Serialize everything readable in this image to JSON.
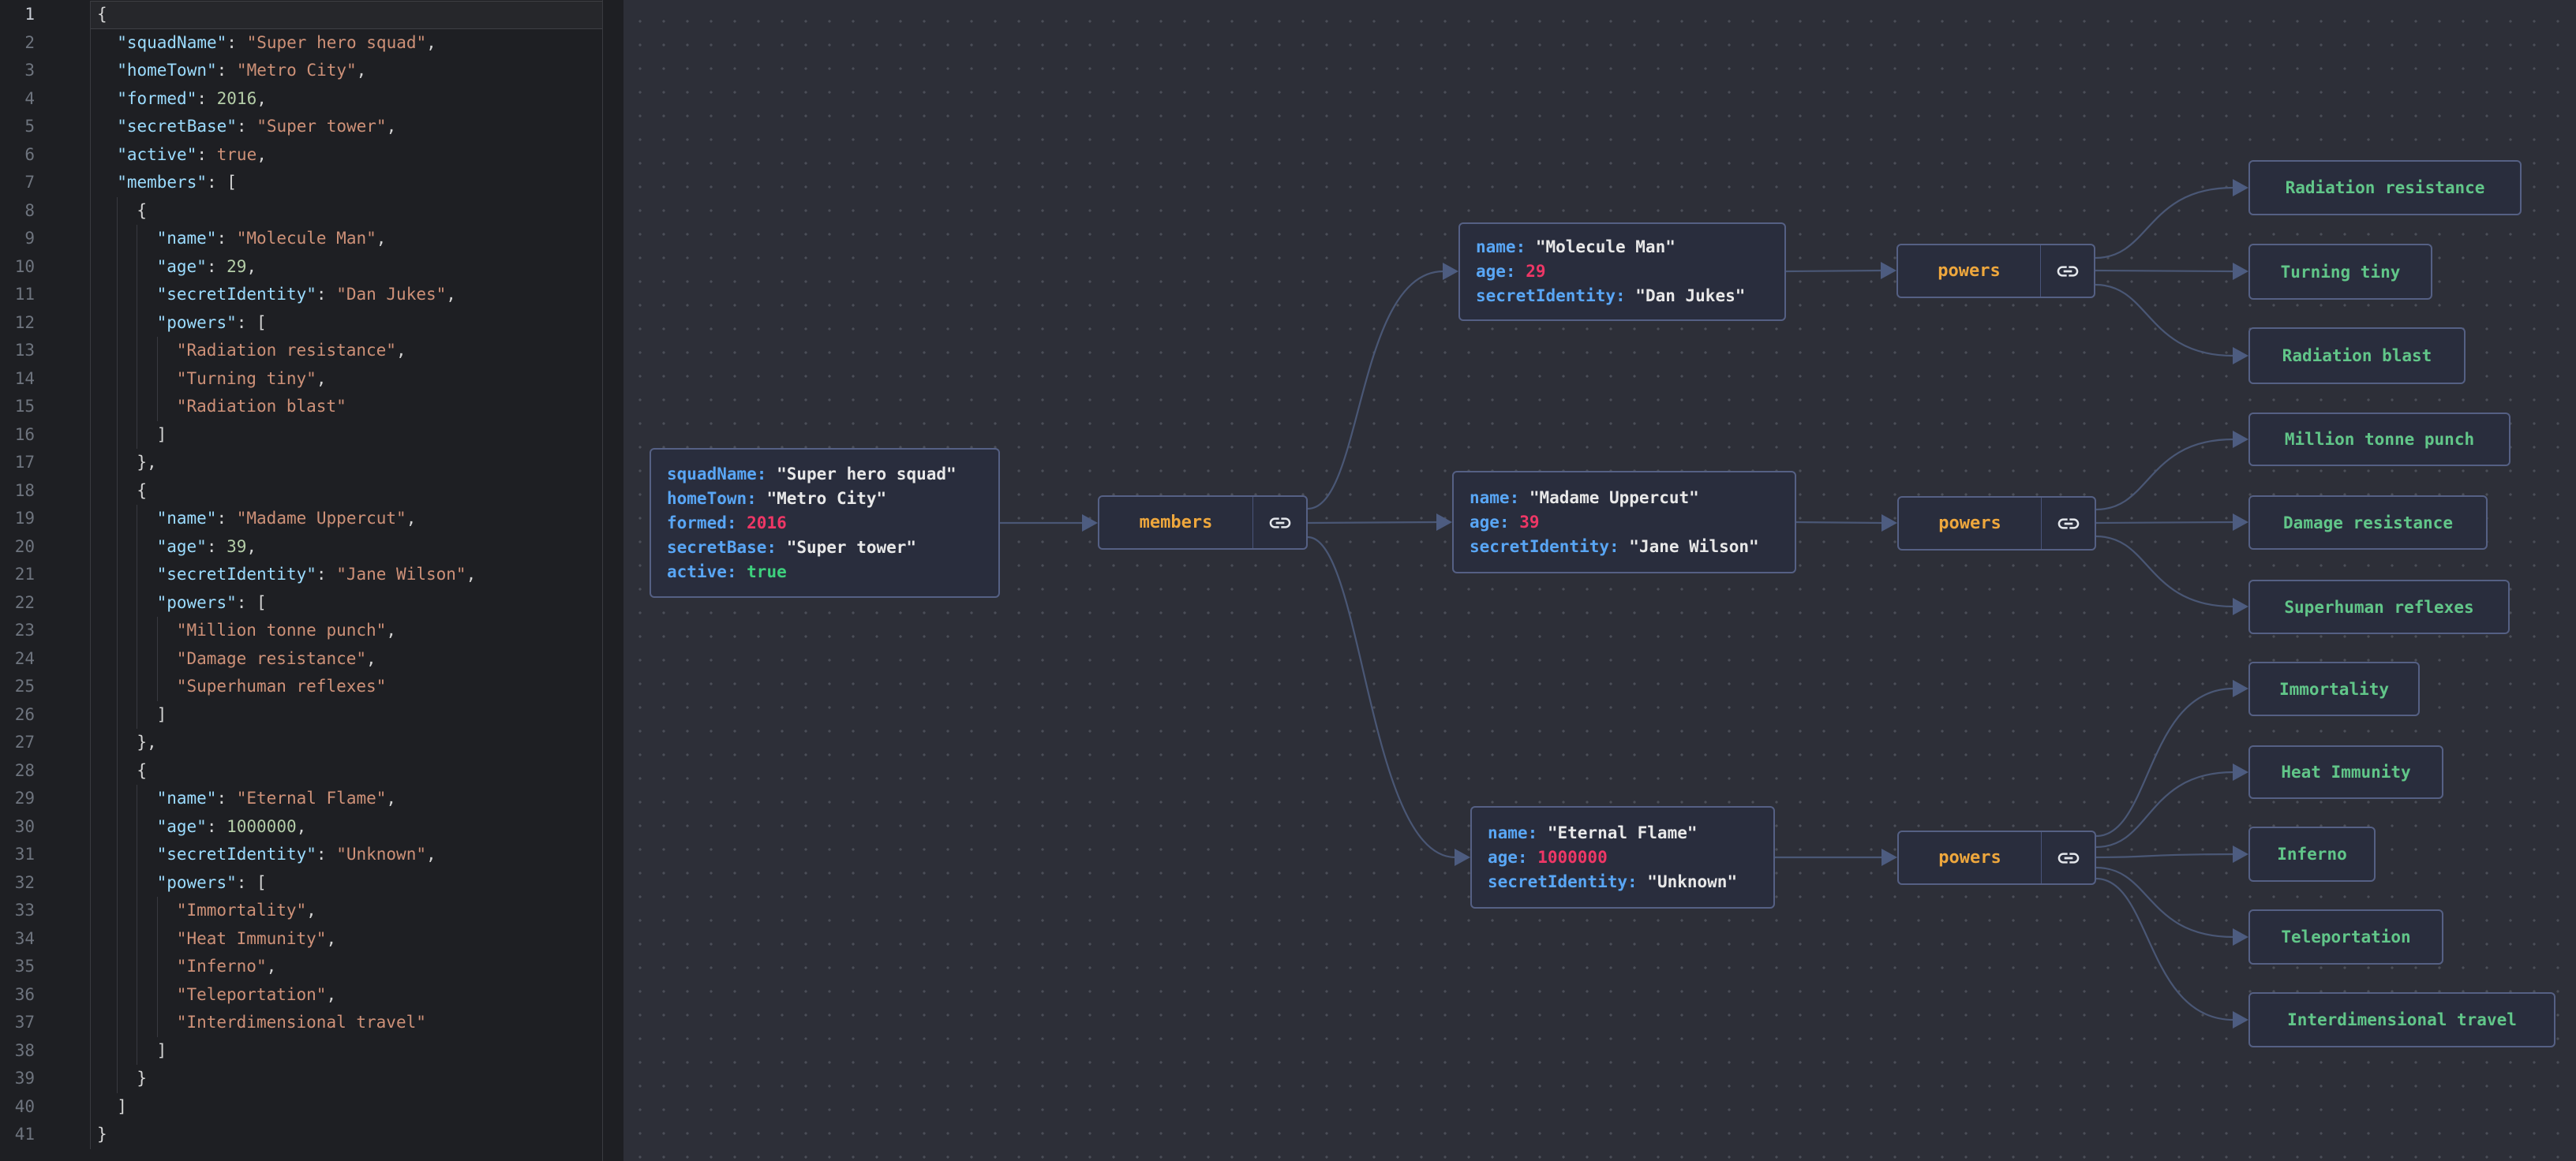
{
  "editor": {
    "lines": [
      {
        "n": 1,
        "i": 0,
        "t": [
          [
            "p",
            "{"
          ]
        ]
      },
      {
        "n": 2,
        "i": 1,
        "t": [
          [
            "k",
            "\"squadName\""
          ],
          [
            "p",
            ": "
          ],
          [
            "s",
            "\"Super hero squad\""
          ],
          [
            "p",
            ","
          ]
        ]
      },
      {
        "n": 3,
        "i": 1,
        "t": [
          [
            "k",
            "\"homeTown\""
          ],
          [
            "p",
            ": "
          ],
          [
            "s",
            "\"Metro City\""
          ],
          [
            "p",
            ","
          ]
        ]
      },
      {
        "n": 4,
        "i": 1,
        "t": [
          [
            "k",
            "\"formed\""
          ],
          [
            "p",
            ": "
          ],
          [
            "n",
            "2016"
          ],
          [
            "p",
            ","
          ]
        ]
      },
      {
        "n": 5,
        "i": 1,
        "t": [
          [
            "k",
            "\"secretBase\""
          ],
          [
            "p",
            ": "
          ],
          [
            "s",
            "\"Super tower\""
          ],
          [
            "p",
            ","
          ]
        ]
      },
      {
        "n": 6,
        "i": 1,
        "t": [
          [
            "k",
            "\"active\""
          ],
          [
            "p",
            ": "
          ],
          [
            "b",
            "true"
          ],
          [
            "p",
            ","
          ]
        ]
      },
      {
        "n": 7,
        "i": 1,
        "t": [
          [
            "k",
            "\"members\""
          ],
          [
            "p",
            ": ["
          ]
        ]
      },
      {
        "n": 8,
        "i": 2,
        "t": [
          [
            "p",
            "{"
          ]
        ]
      },
      {
        "n": 9,
        "i": 3,
        "t": [
          [
            "k",
            "\"name\""
          ],
          [
            "p",
            ": "
          ],
          [
            "s",
            "\"Molecule Man\""
          ],
          [
            "p",
            ","
          ]
        ]
      },
      {
        "n": 10,
        "i": 3,
        "t": [
          [
            "k",
            "\"age\""
          ],
          [
            "p",
            ": "
          ],
          [
            "n",
            "29"
          ],
          [
            "p",
            ","
          ]
        ]
      },
      {
        "n": 11,
        "i": 3,
        "t": [
          [
            "k",
            "\"secretIdentity\""
          ],
          [
            "p",
            ": "
          ],
          [
            "s",
            "\"Dan Jukes\""
          ],
          [
            "p",
            ","
          ]
        ]
      },
      {
        "n": 12,
        "i": 3,
        "t": [
          [
            "k",
            "\"powers\""
          ],
          [
            "p",
            ": ["
          ]
        ]
      },
      {
        "n": 13,
        "i": 4,
        "t": [
          [
            "s",
            "\"Radiation resistance\""
          ],
          [
            "p",
            ","
          ]
        ]
      },
      {
        "n": 14,
        "i": 4,
        "t": [
          [
            "s",
            "\"Turning tiny\""
          ],
          [
            "p",
            ","
          ]
        ]
      },
      {
        "n": 15,
        "i": 4,
        "t": [
          [
            "s",
            "\"Radiation blast\""
          ]
        ]
      },
      {
        "n": 16,
        "i": 3,
        "t": [
          [
            "p",
            "]"
          ]
        ]
      },
      {
        "n": 17,
        "i": 2,
        "t": [
          [
            "p",
            "},"
          ]
        ]
      },
      {
        "n": 18,
        "i": 2,
        "t": [
          [
            "p",
            "{"
          ]
        ]
      },
      {
        "n": 19,
        "i": 3,
        "t": [
          [
            "k",
            "\"name\""
          ],
          [
            "p",
            ": "
          ],
          [
            "s",
            "\"Madame Uppercut\""
          ],
          [
            "p",
            ","
          ]
        ]
      },
      {
        "n": 20,
        "i": 3,
        "t": [
          [
            "k",
            "\"age\""
          ],
          [
            "p",
            ": "
          ],
          [
            "n",
            "39"
          ],
          [
            "p",
            ","
          ]
        ]
      },
      {
        "n": 21,
        "i": 3,
        "t": [
          [
            "k",
            "\"secretIdentity\""
          ],
          [
            "p",
            ": "
          ],
          [
            "s",
            "\"Jane Wilson\""
          ],
          [
            "p",
            ","
          ]
        ]
      },
      {
        "n": 22,
        "i": 3,
        "t": [
          [
            "k",
            "\"powers\""
          ],
          [
            "p",
            ": ["
          ]
        ]
      },
      {
        "n": 23,
        "i": 4,
        "t": [
          [
            "s",
            "\"Million tonne punch\""
          ],
          [
            "p",
            ","
          ]
        ]
      },
      {
        "n": 24,
        "i": 4,
        "t": [
          [
            "s",
            "\"Damage resistance\""
          ],
          [
            "p",
            ","
          ]
        ]
      },
      {
        "n": 25,
        "i": 4,
        "t": [
          [
            "s",
            "\"Superhuman reflexes\""
          ]
        ]
      },
      {
        "n": 26,
        "i": 3,
        "t": [
          [
            "p",
            "]"
          ]
        ]
      },
      {
        "n": 27,
        "i": 2,
        "t": [
          [
            "p",
            "},"
          ]
        ]
      },
      {
        "n": 28,
        "i": 2,
        "t": [
          [
            "p",
            "{"
          ]
        ]
      },
      {
        "n": 29,
        "i": 3,
        "t": [
          [
            "k",
            "\"name\""
          ],
          [
            "p",
            ": "
          ],
          [
            "s",
            "\"Eternal Flame\""
          ],
          [
            "p",
            ","
          ]
        ]
      },
      {
        "n": 30,
        "i": 3,
        "t": [
          [
            "k",
            "\"age\""
          ],
          [
            "p",
            ": "
          ],
          [
            "n",
            "1000000"
          ],
          [
            "p",
            ","
          ]
        ]
      },
      {
        "n": 31,
        "i": 3,
        "t": [
          [
            "k",
            "\"secretIdentity\""
          ],
          [
            "p",
            ": "
          ],
          [
            "s",
            "\"Unknown\""
          ],
          [
            "p",
            ","
          ]
        ]
      },
      {
        "n": 32,
        "i": 3,
        "t": [
          [
            "k",
            "\"powers\""
          ],
          [
            "p",
            ": ["
          ]
        ]
      },
      {
        "n": 33,
        "i": 4,
        "t": [
          [
            "s",
            "\"Immortality\""
          ],
          [
            "p",
            ","
          ]
        ]
      },
      {
        "n": 34,
        "i": 4,
        "t": [
          [
            "s",
            "\"Heat Immunity\""
          ],
          [
            "p",
            ","
          ]
        ]
      },
      {
        "n": 35,
        "i": 4,
        "t": [
          [
            "s",
            "\"Inferno\""
          ],
          [
            "p",
            ","
          ]
        ]
      },
      {
        "n": 36,
        "i": 4,
        "t": [
          [
            "s",
            "\"Teleportation\""
          ],
          [
            "p",
            ","
          ]
        ]
      },
      {
        "n": 37,
        "i": 4,
        "t": [
          [
            "s",
            "\"Interdimensional travel\""
          ]
        ]
      },
      {
        "n": 38,
        "i": 3,
        "t": [
          [
            "p",
            "]"
          ]
        ]
      },
      {
        "n": 39,
        "i": 2,
        "t": [
          [
            "p",
            "}"
          ]
        ]
      },
      {
        "n": 40,
        "i": 1,
        "t": [
          [
            "p",
            "]"
          ]
        ]
      },
      {
        "n": 41,
        "i": 0,
        "t": [
          [
            "p",
            "}"
          ]
        ]
      }
    ]
  },
  "graph": {
    "root": {
      "fields": [
        [
          "squadName",
          "\"Super hero squad\"",
          "s"
        ],
        [
          "homeTown",
          "\"Metro City\"",
          "s"
        ],
        [
          "formed",
          "2016",
          "n"
        ],
        [
          "secretBase",
          "\"Super tower\"",
          "s"
        ],
        [
          "active",
          "true",
          "b"
        ]
      ]
    },
    "members_label": "members",
    "powers_label": "powers",
    "member_details": [
      {
        "fields": [
          [
            "name",
            "\"Molecule Man\"",
            "s"
          ],
          [
            "age",
            "29",
            "n"
          ],
          [
            "secretIdentity",
            "\"Dan Jukes\"",
            "s"
          ]
        ]
      },
      {
        "fields": [
          [
            "name",
            "\"Madame Uppercut\"",
            "s"
          ],
          [
            "age",
            "39",
            "n"
          ],
          [
            "secretIdentity",
            "\"Jane Wilson\"",
            "s"
          ]
        ]
      },
      {
        "fields": [
          [
            "name",
            "\"Eternal Flame\"",
            "s"
          ],
          [
            "age",
            "1000000",
            "n"
          ],
          [
            "secretIdentity",
            "\"Unknown\"",
            "s"
          ]
        ]
      }
    ],
    "leaves": [
      "Radiation resistance",
      "Turning tiny",
      "Radiation blast",
      "Million tonne punch",
      "Damage resistance",
      "Superhuman reflexes",
      "Immortality",
      "Heat Immunity",
      "Inferno",
      "Teleportation",
      "Interdimensional travel"
    ],
    "link_icon": "link-icon"
  },
  "colors": {
    "editorBg": "#1e1f23",
    "gutterLine": "#3a3b40",
    "lineNum": "#6e747e",
    "lineNumActive": "#c8ccd4",
    "activeLineBg": "#26272b",
    "activeLineBorder": "#3f4045",
    "guide": "#383940",
    "key": "#9cdcfe",
    "str": "#ce9178",
    "num": "#b5cea8",
    "bool": "#ce9178",
    "punct": "#d4d4d4",
    "canvasBg": "#2d2f38",
    "dot": "#4b4e58",
    "nodeBg": "#292d3d",
    "nodeBorder": "#556084",
    "edge": "#4a5775",
    "arrow": "#4d5c80",
    "divider": "#49547a",
    "nodeKey": "#59a6f5",
    "nodeStr": "#e8e8e8",
    "nodeNum": "#ee3766",
    "nodeBool": "#3ed17d",
    "amber": "#eea73d",
    "leafGreen": "#61c689",
    "icon": "#e4e7ec"
  }
}
